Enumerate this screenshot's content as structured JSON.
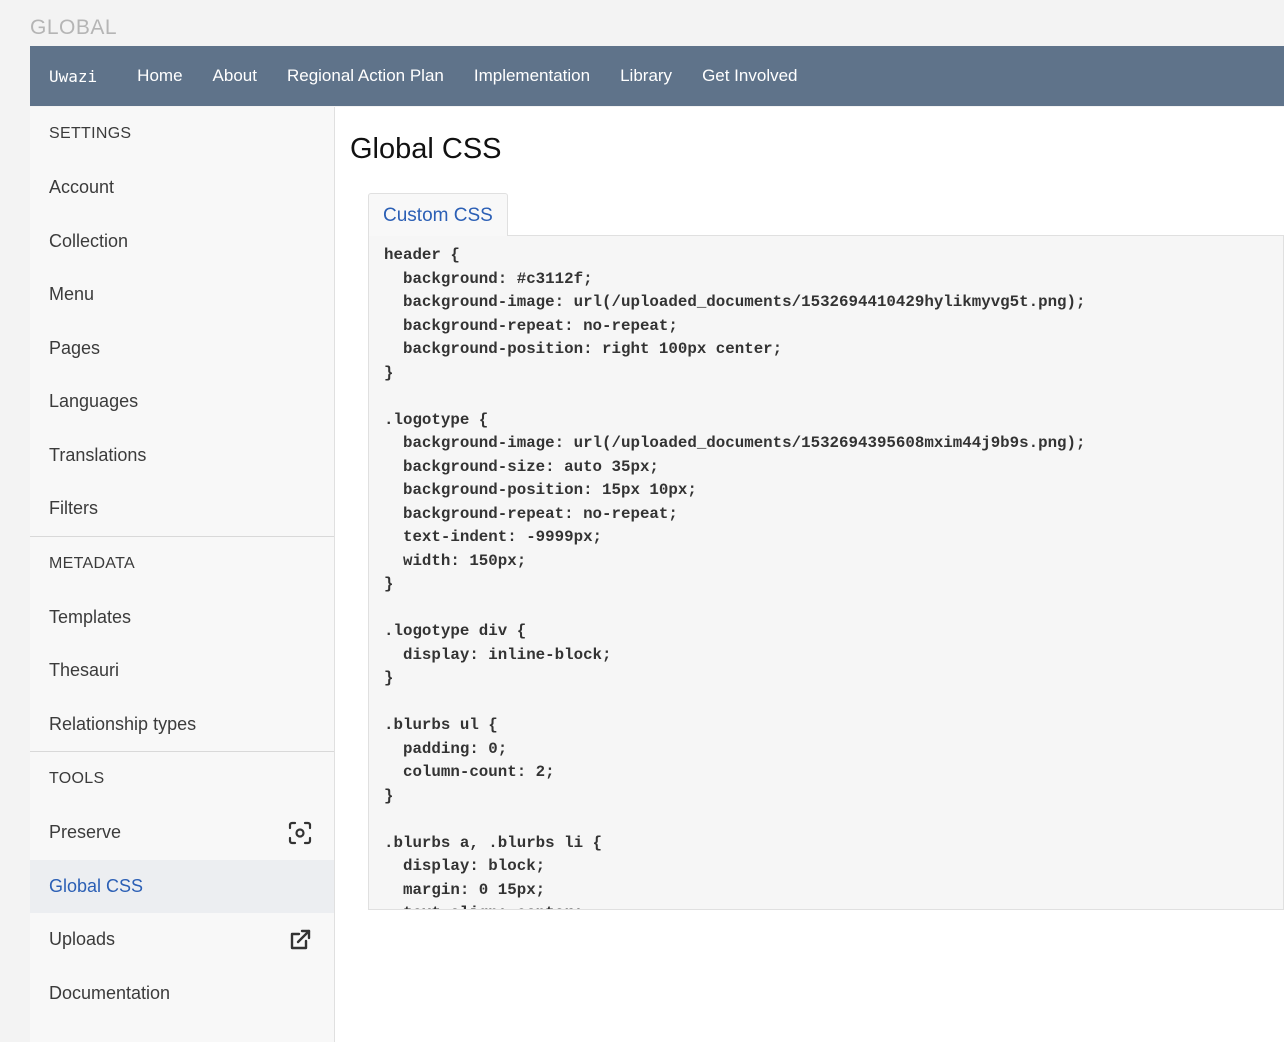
{
  "page_label": "GLOBAL",
  "navbar": {
    "brand": "Uwazi",
    "links": [
      "Home",
      "About",
      "Regional Action Plan",
      "Implementation",
      "Library",
      "Get Involved"
    ]
  },
  "sidebar": {
    "settings_title": "SETTINGS",
    "settings_items": [
      "Account",
      "Collection",
      "Menu",
      "Pages",
      "Languages",
      "Translations",
      "Filters"
    ],
    "metadata_title": "METADATA",
    "metadata_items": [
      "Templates",
      "Thesauri",
      "Relationship types"
    ],
    "tools_title": "TOOLS",
    "tools_items": [
      {
        "label": "Preserve",
        "icon": "scan-icon"
      },
      {
        "label": "Global CSS",
        "active": true
      },
      {
        "label": "Uploads",
        "icon": "external-link-icon"
      },
      {
        "label": "Documentation"
      }
    ]
  },
  "main": {
    "title": "Global CSS",
    "tab_label": "Custom CSS",
    "css_code": "header {\n  background: #c3112f;\n  background-image: url(/uploaded_documents/1532694410429hylikmyvg5t.png);\n  background-repeat: no-repeat;\n  background-position: right 100px center;\n}\n\n.logotype {\n  background-image: url(/uploaded_documents/1532694395608mxim44j9b9s.png);\n  background-size: auto 35px;\n  background-position: 15px 10px;\n  background-repeat: no-repeat;\n  text-indent: -9999px;\n  width: 150px;\n}\n\n.logotype div {\n  display: inline-block;\n}\n\n.blurbs ul {\n  padding: 0;\n  column-count: 2;\n}\n\n.blurbs a, .blurbs li {\n  display: block;\n  margin: 0 15px;\n  text-align: center;\n}"
  },
  "colors": {
    "navbar_bg": "#5f738a",
    "active_text": "#2b5fb5"
  }
}
